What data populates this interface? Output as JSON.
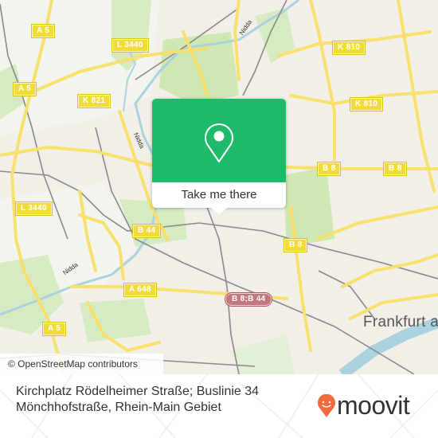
{
  "map": {
    "attribution": "© OpenStreetMap contributors",
    "city_label": "Frankfurt am Main",
    "road_shields": [
      {
        "id": "a5-top",
        "label": "A 5",
        "type": "yellow"
      },
      {
        "id": "a5-mid",
        "label": "A 5",
        "type": "yellow"
      },
      {
        "id": "a5-bottom",
        "label": "A 5",
        "type": "yellow"
      },
      {
        "id": "l3440-top",
        "label": "L 3440",
        "type": "yellow"
      },
      {
        "id": "l3440-left",
        "label": "L 3440",
        "type": "yellow"
      },
      {
        "id": "k821",
        "label": "K 821",
        "type": "yellow"
      },
      {
        "id": "k810-top",
        "label": "K 810",
        "type": "yellow"
      },
      {
        "id": "k810-mid",
        "label": "K 810",
        "type": "yellow"
      },
      {
        "id": "b8-left",
        "label": "B 8",
        "type": "yellow"
      },
      {
        "id": "b8-right",
        "label": "B 8",
        "type": "yellow"
      },
      {
        "id": "b8-lower",
        "label": "B 8",
        "type": "yellow"
      },
      {
        "id": "b44",
        "label": "B 44",
        "type": "yellow"
      },
      {
        "id": "a648",
        "label": "A 648",
        "type": "yellow"
      },
      {
        "id": "b8-b44",
        "label": "B 8;B 44",
        "type": "red"
      }
    ],
    "water_labels": [
      {
        "id": "nidda-top",
        "label": "Nidda"
      },
      {
        "id": "nidda-mid",
        "label": "Nidda"
      },
      {
        "id": "nidda-bottom",
        "label": "Nidda"
      }
    ]
  },
  "popup": {
    "icon": "location-pin-icon",
    "cta_label": "Take me there",
    "color": "#1dbb6a"
  },
  "footer": {
    "title_line1": "Kirchplatz Rödelheimer Straße; Buslinie 34",
    "title_line2": "Mönchhofstraße, Rhein-Main Gebiet",
    "brand": "moovit",
    "brand_color": "#f26a3d"
  }
}
